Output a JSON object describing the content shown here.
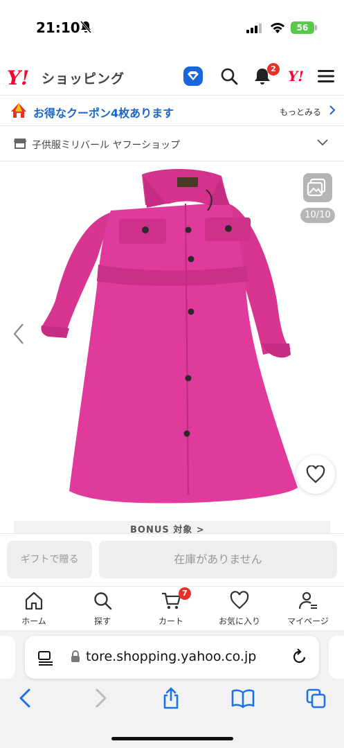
{
  "status": {
    "time": "21:10",
    "battery": "56"
  },
  "header": {
    "logo_y": "Y!",
    "logo_text": "ショッピング",
    "notification_count": "2",
    "yahoo_mark": "Y!"
  },
  "coupon": {
    "text": "お得なクーポン4枚あります",
    "more": "もっとみる"
  },
  "store": {
    "name": "子供服ミリバール ヤフーショップ"
  },
  "gallery": {
    "counter": "10/10"
  },
  "bonus": {
    "text": "BONUS 対象 >"
  },
  "actions": {
    "gift": "ギフトで贈る",
    "stock": "在庫がありません"
  },
  "tabs": [
    {
      "label": "ホーム",
      "icon": "home-icon"
    },
    {
      "label": "探す",
      "icon": "search-icon"
    },
    {
      "label": "カート",
      "icon": "cart-icon"
    },
    {
      "label": "お気に入り",
      "icon": "heart-icon"
    },
    {
      "label": "マイページ",
      "icon": "user-icon"
    }
  ],
  "cart_count": "7",
  "browser": {
    "url": "tore.shopping.yahoo.co.jp"
  },
  "colors": {
    "brand_red": "#ff0033",
    "coupon_blue": "#1a66c9",
    "badge_red": "#e9312b",
    "product_pink": "#e03a9c"
  }
}
